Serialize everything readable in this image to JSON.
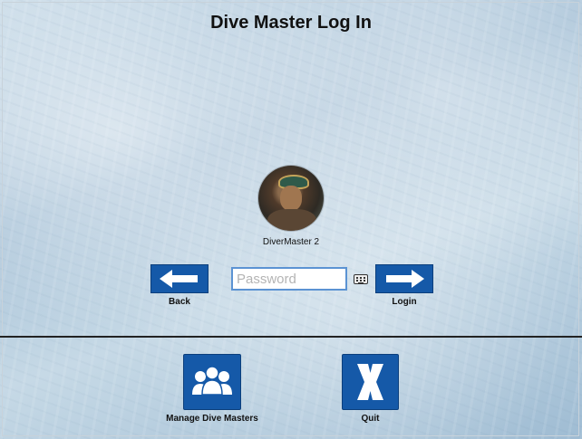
{
  "screen": {
    "title": "Dive Master Log In"
  },
  "user": {
    "name": "DiverMaster 2",
    "avatar_icon": "diver-portrait"
  },
  "login_form": {
    "password_placeholder": "Password",
    "password_value": "",
    "back_label": "Back",
    "login_label": "Login",
    "back_icon": "arrow-left-icon",
    "login_icon": "arrow-right-icon",
    "keyboard_icon": "keyboard-icon"
  },
  "actions": {
    "manage_label": "Manage Dive Masters",
    "manage_icon": "people-group-icon",
    "quit_label": "Quit",
    "quit_icon": "x-icon"
  },
  "colors": {
    "button_blue": "#1559a8",
    "input_border": "#5b93d3"
  }
}
